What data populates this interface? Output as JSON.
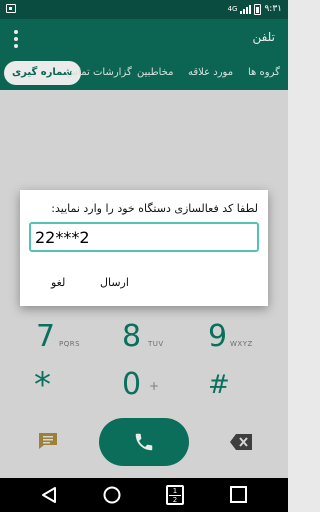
{
  "status_bar": {
    "time": "۹:۳۱",
    "network": "4G"
  },
  "app_bar": {
    "title": "تلفن"
  },
  "tabs": [
    {
      "label": "شماره گیری",
      "active": true
    },
    {
      "label": "گزارشات تماس",
      "active": false
    },
    {
      "label": "مخاطبین",
      "active": false
    },
    {
      "label": "مورد علاقه",
      "active": false
    },
    {
      "label": "گروه ها",
      "active": false
    }
  ],
  "dialog": {
    "title": "لطفا کد فعالسازی دستگاه خود را وارد نمایید:",
    "input_value": "22***2",
    "send_label": "ارسال",
    "cancel_label": "لغو"
  },
  "dialpad": {
    "keys": [
      {
        "digit": "7",
        "letters": "PQRS"
      },
      {
        "digit": "8",
        "letters": "TUV"
      },
      {
        "digit": "9",
        "letters": "WXYZ"
      },
      {
        "digit": "*",
        "letters": ""
      },
      {
        "digit": "0",
        "letters": "+"
      },
      {
        "digit": "#",
        "letters": ""
      }
    ]
  },
  "nav_bar": {
    "dual_sim_top": "1",
    "dual_sim_bottom": "2"
  },
  "colors": {
    "primary": "#0c6e5a",
    "primary_dark": "#0a4c3f",
    "accent": "#54c3b7",
    "key_color": "#0b7a66"
  }
}
